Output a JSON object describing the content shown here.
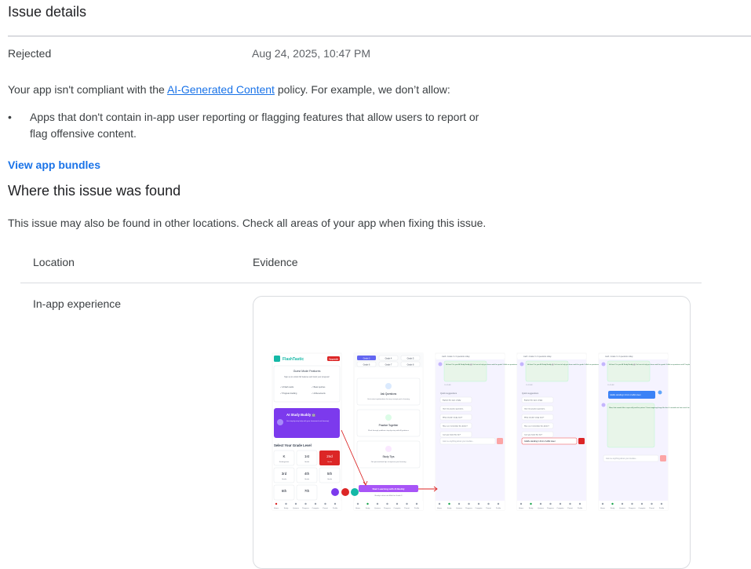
{
  "header": {
    "title": "Issue details"
  },
  "status": {
    "label": "Rejected",
    "date": "Aug 24, 2025, 10:47 PM"
  },
  "policy": {
    "prefix": "Your app isn't compliant with the ",
    "link": "AI-Generated Content",
    "suffix": " policy. For example, we don’t allow:"
  },
  "bullets": [
    "Apps that don't contain in-app user reporting or flagging features that allow users to report or flag offensive content."
  ],
  "bullet_symbol": "•",
  "actions": {
    "view_bundles": "View app bundles"
  },
  "section": {
    "title": "Where this issue was found",
    "description": "This issue may also be found in other locations. Check all areas of your app when fixing this issue."
  },
  "table": {
    "headers": {
      "location": "Location",
      "evidence": "Evidence"
    },
    "rows": [
      {
        "location": "In-app experience"
      }
    ]
  },
  "evidence_screens": {
    "app_name": "FlashTastic",
    "badge": "Upgrade",
    "guest_title": "Guest Mode Features",
    "guest_sub": "Sign up to unlock full features and track your progress!",
    "features": [
      "✓ AI flash cards",
      "✓ Basic quizzes",
      "✓ Progress tracking",
      "✓ Achievements"
    ],
    "buddy_title": "AI Study Buddy 🤖",
    "buddy_sub": "Get step-by-step help with your homework and learning!",
    "grade_title": "Select Your Grade Level",
    "grades": [
      "K",
      "1st",
      "2nd",
      "3rd",
      "4th",
      "5th",
      "6th",
      "7th"
    ],
    "grade_sub": [
      "Kindergarten",
      "Grade",
      "Grade",
      "Grade",
      "Grade",
      "Grade",
      "",
      ""
    ],
    "grade_pills": [
      "Grade 3",
      "Grade 4",
      "Grade 5",
      "Grade 6",
      "Grade 7",
      "Grade 8"
    ],
    "cards": [
      {
        "title": "Ask Questions",
        "sub": "Get instant explanations for any concept you're learning"
      },
      {
        "title": "Practice Together",
        "sub": "Work through problems step-by-step with AI guidance"
      },
      {
        "title": "Study Tips",
        "sub": "Get personalized tips to improve your learning"
      }
    ],
    "start_button": "Start Learning with AI Buddy",
    "ready_text": "Ready to dive into Math for Grade 3",
    "chat_header": "math • Grade 3 • 0 questions today",
    "bot_greeting": "Hi there! I'm your AI Study Buddy 🤖 I'm here to help you learn math for grade 3. Ask me questions and I'll explain concepts, give examples, or help you practice!",
    "quick_title": "Quick suggestions",
    "suggestions": [
      "Explain this topic simply",
      "Give me practice questions",
      "What should I study next?",
      "How can I remember this better?",
      "Can you make this fun?"
    ],
    "input_placeholder": "Ask me anything about your studies...",
    "typed_input": "Giraffe standing in front of eiffel tower",
    "user_msg": "Giraffe standing in front of eiffel tower",
    "bot_reply": "Wow, that sounds like a super silly and fun picture! I love imagining things like that. It reminds me how much fun we can have with numbers and shapes too! Are you ready to dive into some exciting math today, or do you have a specific math question you'd like to explore? What math topic sounds fun to learn about right now? 😊",
    "time_label": "10:42 AM",
    "nav": [
      "Home",
      "Study",
      "Quizzes",
      "Progress",
      "Compete",
      "Parent",
      "Profile"
    ],
    "colors": {
      "purple": "#7c3aed",
      "red": "#dc2626",
      "teal": "#14b8a6",
      "lavender": "#f5f3ff",
      "bubble": "#e8f5e9",
      "user_bubble": "#3b82f6"
    }
  }
}
